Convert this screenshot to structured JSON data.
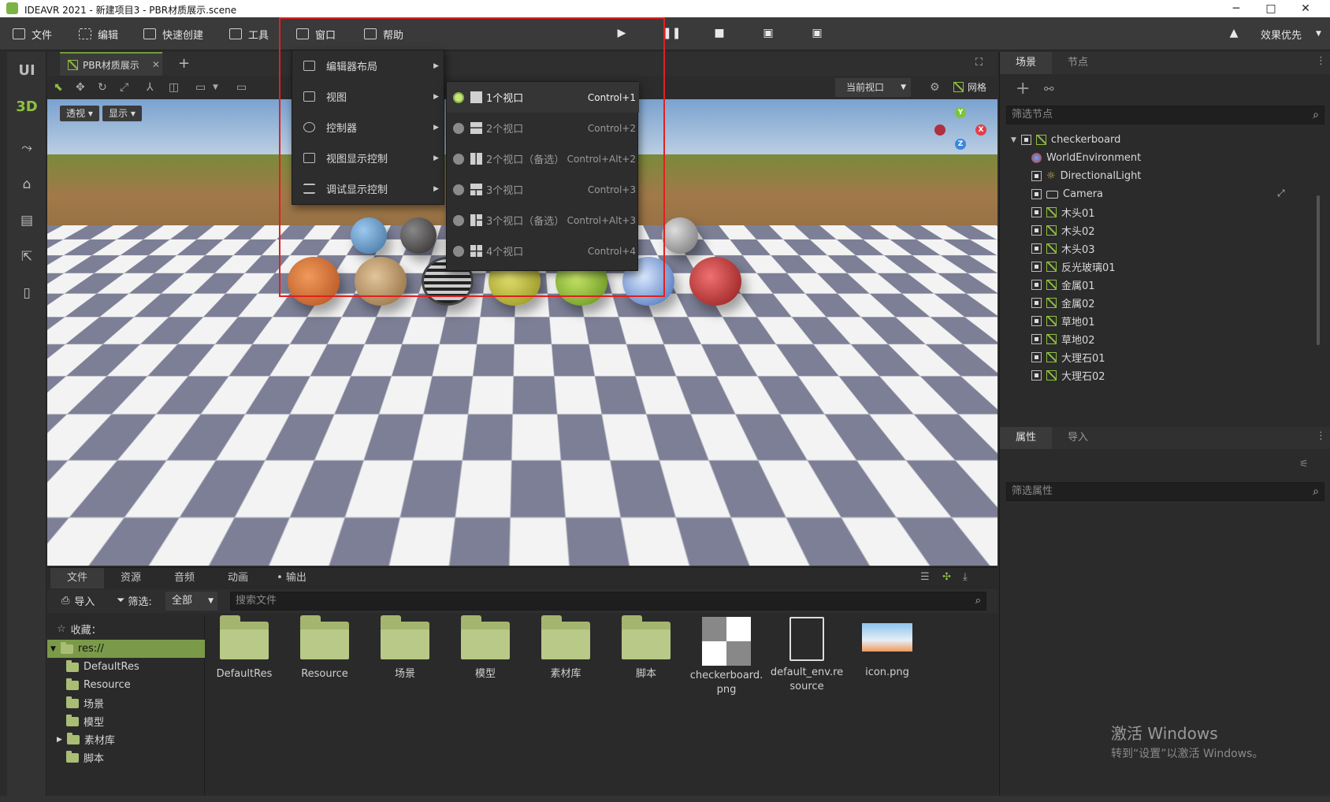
{
  "window": {
    "title": "IDEAVR 2021 - 新建项目3 - PBR材质展示.scene",
    "minimize": "─",
    "maximize": "□",
    "close": "✕"
  },
  "menubar": {
    "items": [
      {
        "label": "文件",
        "icon": "folder-icon"
      },
      {
        "label": "编辑",
        "icon": "crop-icon"
      },
      {
        "label": "快速创建",
        "icon": "edit-icon"
      },
      {
        "label": "工具",
        "icon": "window-icon"
      },
      {
        "label": "窗口",
        "icon": "frame-icon"
      },
      {
        "label": "帮助",
        "icon": "book-icon"
      }
    ],
    "quality_label": "效果优先"
  },
  "rail": {
    "ui_label": "UI",
    "3d_label": "3D"
  },
  "viewport": {
    "tab_title": "PBR材质展示",
    "add_tab": "+",
    "perspective_label": "透视",
    "display_label": "显示",
    "current_view_label": "当前视口",
    "grid_label": "网格",
    "gizmo": {
      "y": "Y",
      "x": "X",
      "z": "Z"
    }
  },
  "window_menu": {
    "items": [
      {
        "label": "编辑器布局",
        "icon": "layout-icon"
      },
      {
        "label": "视图",
        "icon": "view-icon"
      },
      {
        "label": "控制器",
        "icon": "controller-icon"
      },
      {
        "label": "视图显示控制",
        "icon": "display-control-icon"
      },
      {
        "label": "调试显示控制",
        "icon": "debug-control-icon"
      }
    ]
  },
  "view_submenu": {
    "items": [
      {
        "label": "1个视口",
        "shortcut": "Control+1",
        "active": true
      },
      {
        "label": "2个视口",
        "shortcut": "Control+2",
        "active": false
      },
      {
        "label": "2个视口（备选）",
        "shortcut": "Control+Alt+2",
        "active": false
      },
      {
        "label": "3个视口",
        "shortcut": "Control+3",
        "active": false
      },
      {
        "label": "3个视口（备选）",
        "shortcut": "Control+Alt+3",
        "active": false
      },
      {
        "label": "4个视口",
        "shortcut": "Control+4",
        "active": false
      }
    ]
  },
  "scene_panel": {
    "tab_scene": "场景",
    "tab_node": "节点",
    "filter_placeholder": "筛选节点",
    "nodes": [
      {
        "name": "checkerboard",
        "type": "mesh"
      },
      {
        "name": "WorldEnvironment",
        "type": "env"
      },
      {
        "name": "DirectionalLight",
        "type": "light"
      },
      {
        "name": "Camera",
        "type": "camera"
      },
      {
        "name": "木头01",
        "type": "mesh"
      },
      {
        "name": "木头02",
        "type": "mesh"
      },
      {
        "name": "木头03",
        "type": "mesh"
      },
      {
        "name": "反光玻璃01",
        "type": "mesh"
      },
      {
        "name": "金属01",
        "type": "mesh"
      },
      {
        "name": "金属02",
        "type": "mesh"
      },
      {
        "name": "草地01",
        "type": "mesh"
      },
      {
        "name": "草地02",
        "type": "mesh"
      },
      {
        "name": "大理石01",
        "type": "mesh"
      },
      {
        "name": "大理石02",
        "type": "mesh"
      }
    ]
  },
  "props_panel": {
    "tab_props": "属性",
    "tab_import": "导入",
    "filter_placeholder": "筛选属性"
  },
  "file_panel": {
    "tabs": [
      "文件",
      "资源",
      "音频",
      "动画",
      "• 输出"
    ],
    "import_label": "导入",
    "filter_label": "筛选:",
    "filter_value": "全部",
    "search_placeholder": "搜索文件",
    "favorites_label": "收藏：",
    "tree": [
      "res://",
      "DefaultRes",
      "Resource",
      "场景",
      "模型",
      "素材库",
      "脚本"
    ],
    "grid": [
      {
        "name": "DefaultRes",
        "kind": "folder"
      },
      {
        "name": "Resource",
        "kind": "folder"
      },
      {
        "name": "场景",
        "kind": "folder"
      },
      {
        "name": "模型",
        "kind": "folder"
      },
      {
        "name": "素材库",
        "kind": "folder"
      },
      {
        "name": "脚本",
        "kind": "folder"
      },
      {
        "name": "checkerboard.png",
        "kind": "image"
      },
      {
        "name": "default_env.resource",
        "kind": "file"
      },
      {
        "name": "icon.png",
        "kind": "image"
      }
    ]
  },
  "watermark": {
    "line1": "激活 Windows",
    "line2": "转到“设置”以激活 Windows。"
  },
  "colors": {
    "accent": "#8fbf3f",
    "selection": "#7b9a49",
    "red_box": "#e02020"
  }
}
